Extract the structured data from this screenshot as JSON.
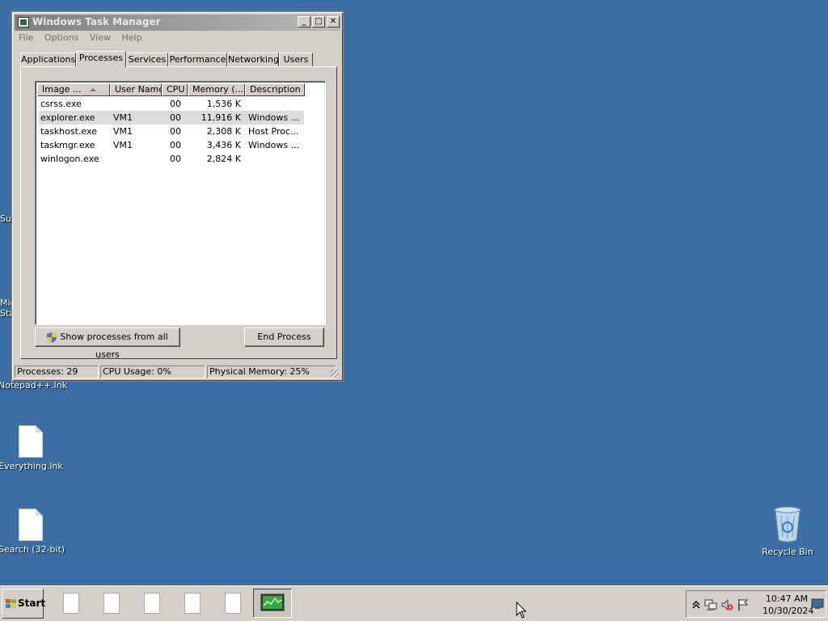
{
  "desktop": {
    "partial_labels": [
      "Su",
      "Mic",
      "Sta"
    ],
    "icons": [
      {
        "label": "Notepad++.lnk"
      },
      {
        "label": "Everything.lnk"
      },
      {
        "label": "Search (32-bit)"
      }
    ],
    "recycle_bin": "Recycle Bin",
    "background": "#3a6ea5"
  },
  "window": {
    "title": "Windows Task Manager",
    "controls": {
      "minimize": "_",
      "maximize": "□",
      "close": "✕"
    },
    "menu": [
      "File",
      "Options",
      "View",
      "Help"
    ],
    "tabs": [
      "Applications",
      "Processes",
      "Services",
      "Performance",
      "Networking",
      "Users"
    ],
    "active_tab": "Processes",
    "columns": [
      "Image ...",
      "User Name",
      "CPU",
      "Memory (...",
      "Description"
    ],
    "rows": [
      {
        "image": "csrss.exe",
        "user": "",
        "cpu": "00",
        "memory": "1,536 K",
        "description": ""
      },
      {
        "image": "explorer.exe",
        "user": "VM1",
        "cpu": "00",
        "memory": "11,916 K",
        "description": "Windows ..."
      },
      {
        "image": "taskhost.exe",
        "user": "VM1",
        "cpu": "00",
        "memory": "2,308 K",
        "description": "Host Proc..."
      },
      {
        "image": "taskmgr.exe",
        "user": "VM1",
        "cpu": "00",
        "memory": "3,436 K",
        "description": "Windows ..."
      },
      {
        "image": "winlogon.exe",
        "user": "",
        "cpu": "00",
        "memory": "2,824 K",
        "description": ""
      }
    ],
    "selected_row": "explorer.exe",
    "show_all_button": "Show processes from all users",
    "end_process_button": "End Process",
    "status": {
      "processes": "Processes: 29",
      "cpu": "CPU Usage: 0%",
      "memory": "Physical Memory: 25%"
    }
  },
  "taskbar": {
    "start_label": "Start",
    "clock_time": "10:47 AM",
    "clock_date": "10/30/2024",
    "tray_icons": [
      "chevron-up-icon",
      "network-icon",
      "volume-muted-icon",
      "action-center-flag-icon",
      "show-desktop-icon"
    ]
  }
}
